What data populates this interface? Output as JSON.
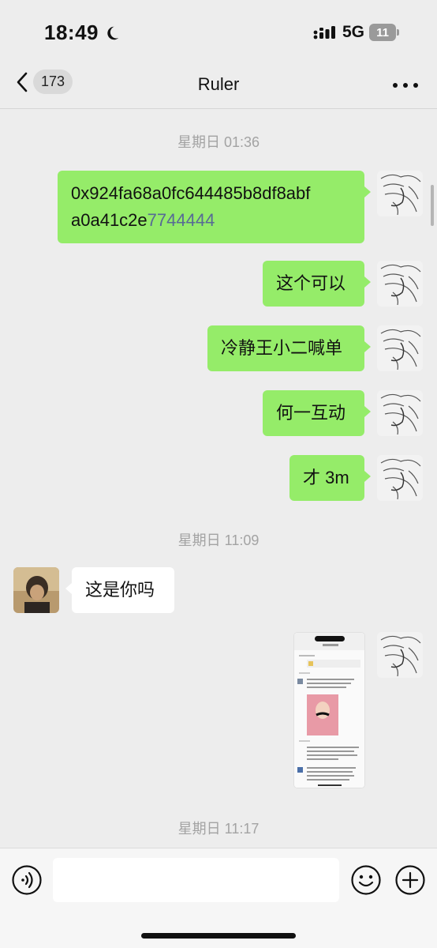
{
  "status_bar": {
    "time": "18:49",
    "network": "5G",
    "battery": "11"
  },
  "nav": {
    "unread_count": "173",
    "title": "Ruler"
  },
  "messages": {
    "ts1": "星期日 01:36",
    "m1_part1": "0x924fa68a0fc644485b8df8abf",
    "m1_part2": "a0a41c2e",
    "m1_link": "7744444",
    "m2": "这个可以",
    "m3": "冷静王小二喊单",
    "m4": "何一互动",
    "m5": "才 3m",
    "ts2": "星期日 11:09",
    "m6": "这是你吗",
    "ts3": "星期日 11:17"
  },
  "colors": {
    "outgoing_bubble": "#95ec69",
    "incoming_bubble": "#ffffff",
    "link": "#576b95",
    "background": "#ededed"
  },
  "icons": [
    "moon-icon",
    "signal-icon",
    "chevron-left-icon",
    "more-icon",
    "voice-icon",
    "emoji-icon",
    "plus-icon"
  ]
}
